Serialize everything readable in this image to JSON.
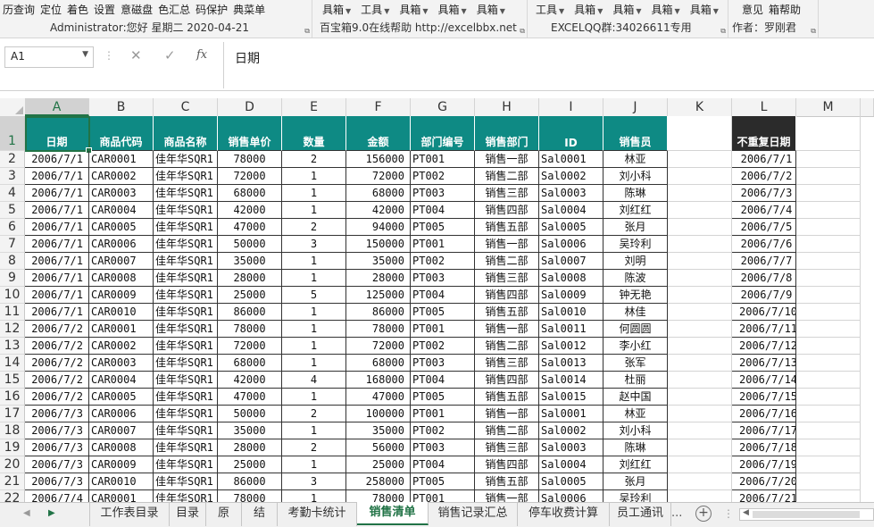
{
  "ribbon": {
    "g1_top": [
      "历查询",
      "定位",
      "着色",
      "设置",
      "意磁盘",
      "色汇总",
      "码保护",
      "典菜单"
    ],
    "g1_info": "Administrator:您好   星期二 2020-04-21",
    "g2_top": [
      {
        "label": "具箱",
        "dd": true
      },
      {
        "label": "工具",
        "dd": true
      },
      {
        "label": "具箱",
        "dd": true
      },
      {
        "label": "具箱",
        "dd": true
      },
      {
        "label": "具箱",
        "dd": true
      }
    ],
    "g2_info": "百宝箱9.0在线帮助  http://excelbbx.net",
    "g3_top": [
      {
        "label": "工具",
        "dd": true
      },
      {
        "label": "具箱",
        "dd": true
      },
      {
        "label": "具箱",
        "dd": true
      },
      {
        "label": "具箱",
        "dd": true
      },
      {
        "label": "具箱",
        "dd": true
      }
    ],
    "g3_info": "EXCELQQ群:34026611专用",
    "g4_top": [
      "意见",
      "箱帮助"
    ],
    "g4_info": "作者：罗刚君"
  },
  "formula_bar": {
    "name_box": "A1",
    "cancel_icon": "✕",
    "enter_icon": "✓",
    "fx_icon": "fx",
    "formula": "日期"
  },
  "columns": [
    "A",
    "B",
    "C",
    "D",
    "E",
    "F",
    "G",
    "H",
    "I",
    "J",
    "K",
    "L",
    "M"
  ],
  "headers": [
    "日期",
    "商品代码",
    "商品名称",
    "销售单价",
    "数量",
    "金额",
    "部门编号",
    "销售部门",
    "ID",
    "销售员",
    "",
    "不重复日期"
  ],
  "rows": [
    {
      "n": "2",
      "a": "2006/7/1",
      "b": "CAR0001",
      "c": "佳年华SQR1",
      "d": "78000",
      "e": "2",
      "f": "156000",
      "g": "PT001",
      "h": "销售一部",
      "i": "Sal0001",
      "j": "林亚",
      "l": "2006/7/1"
    },
    {
      "n": "3",
      "a": "2006/7/1",
      "b": "CAR0002",
      "c": "佳年华SQR1",
      "d": "72000",
      "e": "1",
      "f": "72000",
      "g": "PT002",
      "h": "销售二部",
      "i": "Sal0002",
      "j": "刘小科",
      "l": "2006/7/2"
    },
    {
      "n": "4",
      "a": "2006/7/1",
      "b": "CAR0003",
      "c": "佳年华SQR1",
      "d": "68000",
      "e": "1",
      "f": "68000",
      "g": "PT003",
      "h": "销售三部",
      "i": "Sal0003",
      "j": "陈琳",
      "l": "2006/7/3"
    },
    {
      "n": "5",
      "a": "2006/7/1",
      "b": "CAR0004",
      "c": "佳年华SQR1",
      "d": "42000",
      "e": "1",
      "f": "42000",
      "g": "PT004",
      "h": "销售四部",
      "i": "Sal0004",
      "j": "刘红红",
      "l": "2006/7/4"
    },
    {
      "n": "6",
      "a": "2006/7/1",
      "b": "CAR0005",
      "c": "佳年华SQR1",
      "d": "47000",
      "e": "2",
      "f": "94000",
      "g": "PT005",
      "h": "销售五部",
      "i": "Sal0005",
      "j": "张月",
      "l": "2006/7/5"
    },
    {
      "n": "7",
      "a": "2006/7/1",
      "b": "CAR0006",
      "c": "佳年华SQR1",
      "d": "50000",
      "e": "3",
      "f": "150000",
      "g": "PT001",
      "h": "销售一部",
      "i": "Sal0006",
      "j": "吴玲利",
      "l": "2006/7/6"
    },
    {
      "n": "8",
      "a": "2006/7/1",
      "b": "CAR0007",
      "c": "佳年华SQR1",
      "d": "35000",
      "e": "1",
      "f": "35000",
      "g": "PT002",
      "h": "销售二部",
      "i": "Sal0007",
      "j": "刘明",
      "l": "2006/7/7"
    },
    {
      "n": "9",
      "a": "2006/7/1",
      "b": "CAR0008",
      "c": "佳年华SQR1",
      "d": "28000",
      "e": "1",
      "f": "28000",
      "g": "PT003",
      "h": "销售三部",
      "i": "Sal0008",
      "j": "陈波",
      "l": "2006/7/8"
    },
    {
      "n": "10",
      "a": "2006/7/1",
      "b": "CAR0009",
      "c": "佳年华SQR1",
      "d": "25000",
      "e": "5",
      "f": "125000",
      "g": "PT004",
      "h": "销售四部",
      "i": "Sal0009",
      "j": "钟无艳",
      "l": "2006/7/9"
    },
    {
      "n": "11",
      "a": "2006/7/1",
      "b": "CAR0010",
      "c": "佳年华SQR1",
      "d": "86000",
      "e": "1",
      "f": "86000",
      "g": "PT005",
      "h": "销售五部",
      "i": "Sal0010",
      "j": "林佳",
      "l": "2006/7/10"
    },
    {
      "n": "12",
      "a": "2006/7/2",
      "b": "CAR0001",
      "c": "佳年华SQR1",
      "d": "78000",
      "e": "1",
      "f": "78000",
      "g": "PT001",
      "h": "销售一部",
      "i": "Sal0011",
      "j": "何圆圆",
      "l": "2006/7/11"
    },
    {
      "n": "13",
      "a": "2006/7/2",
      "b": "CAR0002",
      "c": "佳年华SQR1",
      "d": "72000",
      "e": "1",
      "f": "72000",
      "g": "PT002",
      "h": "销售二部",
      "i": "Sal0012",
      "j": "李小红",
      "l": "2006/7/12"
    },
    {
      "n": "14",
      "a": "2006/7/2",
      "b": "CAR0003",
      "c": "佳年华SQR1",
      "d": "68000",
      "e": "1",
      "f": "68000",
      "g": "PT003",
      "h": "销售三部",
      "i": "Sal0013",
      "j": "张军",
      "l": "2006/7/13"
    },
    {
      "n": "15",
      "a": "2006/7/2",
      "b": "CAR0004",
      "c": "佳年华SQR1",
      "d": "42000",
      "e": "4",
      "f": "168000",
      "g": "PT004",
      "h": "销售四部",
      "i": "Sal0014",
      "j": "杜丽",
      "l": "2006/7/14"
    },
    {
      "n": "16",
      "a": "2006/7/2",
      "b": "CAR0005",
      "c": "佳年华SQR1",
      "d": "47000",
      "e": "1",
      "f": "47000",
      "g": "PT005",
      "h": "销售五部",
      "i": "Sal0015",
      "j": "赵中国",
      "l": "2006/7/15"
    },
    {
      "n": "17",
      "a": "2006/7/3",
      "b": "CAR0006",
      "c": "佳年华SQR1",
      "d": "50000",
      "e": "2",
      "f": "100000",
      "g": "PT001",
      "h": "销售一部",
      "i": "Sal0001",
      "j": "林亚",
      "l": "2006/7/16"
    },
    {
      "n": "18",
      "a": "2006/7/3",
      "b": "CAR0007",
      "c": "佳年华SQR1",
      "d": "35000",
      "e": "1",
      "f": "35000",
      "g": "PT002",
      "h": "销售二部",
      "i": "Sal0002",
      "j": "刘小科",
      "l": "2006/7/17"
    },
    {
      "n": "19",
      "a": "2006/7/3",
      "b": "CAR0008",
      "c": "佳年华SQR1",
      "d": "28000",
      "e": "2",
      "f": "56000",
      "g": "PT003",
      "h": "销售三部",
      "i": "Sal0003",
      "j": "陈琳",
      "l": "2006/7/18"
    },
    {
      "n": "20",
      "a": "2006/7/3",
      "b": "CAR0009",
      "c": "佳年华SQR1",
      "d": "25000",
      "e": "1",
      "f": "25000",
      "g": "PT004",
      "h": "销售四部",
      "i": "Sal0004",
      "j": "刘红红",
      "l": "2006/7/19"
    },
    {
      "n": "21",
      "a": "2006/7/3",
      "b": "CAR0010",
      "c": "佳年华SQR1",
      "d": "86000",
      "e": "3",
      "f": "258000",
      "g": "PT005",
      "h": "销售五部",
      "i": "Sal0005",
      "j": "张月",
      "l": "2006/7/20"
    },
    {
      "n": "22",
      "a": "2006/7/4",
      "b": "CAR0001",
      "c": "佳年华SQR1",
      "d": "78000",
      "e": "1",
      "f": "78000",
      "g": "PT001",
      "h": "销售一部",
      "i": "Sal0006",
      "j": "吴玲利",
      "l": "2006/7/21"
    }
  ],
  "header_row_number": "1",
  "sheet_tabs": [
    "工作表目录",
    "目录",
    "原",
    "结",
    "考勤卡统计",
    "销售清单",
    "销售记录汇总",
    "停车收费计算",
    "员工通讯"
  ],
  "active_tab": "销售清单",
  "more_tabs": "...",
  "add_sheet": "+",
  "colors": {
    "header_teal": "#0e8a84",
    "header_dark": "#2b2b2b",
    "accent": "#217346"
  }
}
